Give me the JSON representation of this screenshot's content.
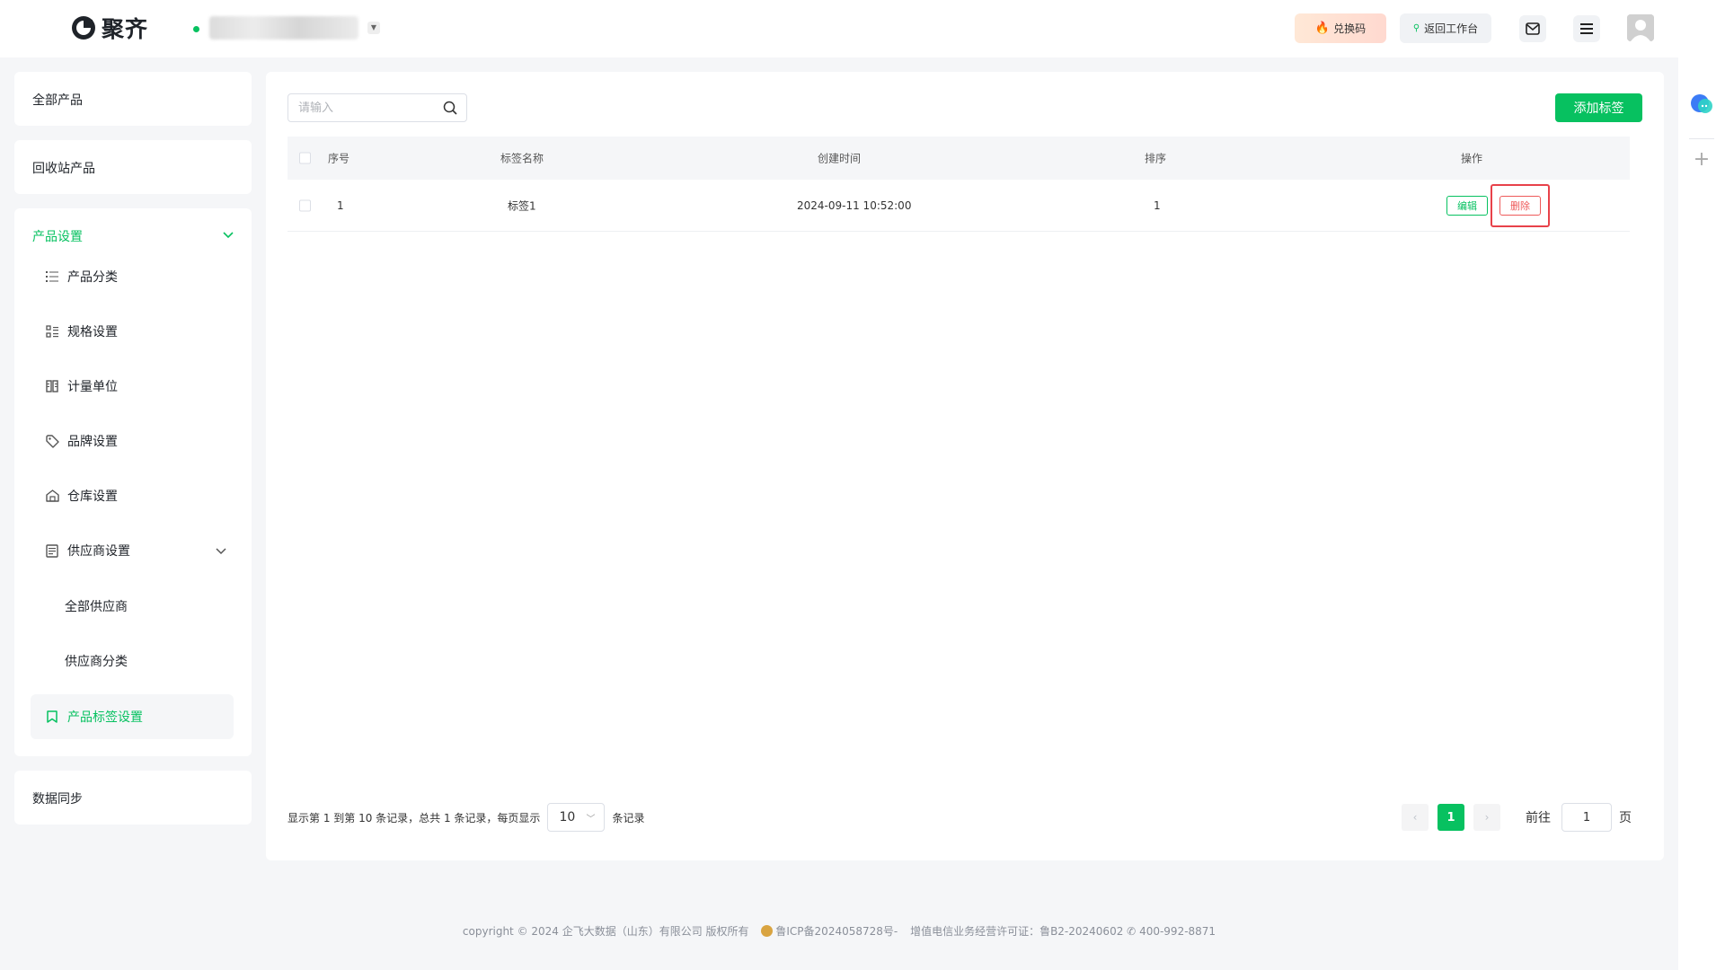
{
  "header": {
    "brand": "聚齐",
    "redeem_label": "兑换码",
    "back_label": "返回工作台"
  },
  "sidebar": {
    "all_products": "全部产品",
    "recycle_products": "回收站产品",
    "product_settings": "产品设置",
    "items": [
      {
        "label": "产品分类",
        "icon": "list-icon"
      },
      {
        "label": "规格设置",
        "icon": "spec-icon"
      },
      {
        "label": "计量单位",
        "icon": "ruler-icon"
      },
      {
        "label": "品牌设置",
        "icon": "tag-icon"
      },
      {
        "label": "仓库设置",
        "icon": "warehouse-icon"
      },
      {
        "label": "供应商设置",
        "icon": "supplier-icon"
      }
    ],
    "supplier_sub": [
      "全部供应商",
      "供应商分类"
    ],
    "tag_settings": "产品标签设置",
    "data_sync": "数据同步"
  },
  "toolbar": {
    "search_placeholder": "请输入",
    "add_label": "添加标签"
  },
  "table": {
    "headers": [
      "序号",
      "标签名称",
      "创建时间",
      "排序",
      "操作"
    ],
    "rows": [
      {
        "index": "1",
        "name": "标签1",
        "created": "2024-09-11 10:52:00",
        "sort": "1",
        "edit": "编辑",
        "delete": "删除"
      }
    ]
  },
  "pagination": {
    "summary": "显示第 1 到第 10 条记录，总共 1 条记录，每页显示",
    "page_size": "10",
    "unit": "条记录",
    "current_page": "1",
    "goto_label": "前往",
    "goto_value": "1",
    "page_suffix": "页"
  },
  "footer": {
    "copyright": "copyright © 2024 企飞大数据（山东）有限公司 版权所有",
    "icp": "鲁ICP备2024058728号-",
    "license": "增值电信业务经营许可证：鲁B2-20240602",
    "phone": "400-992-8871"
  },
  "colors": {
    "accent": "#07c160",
    "danger": "#ee5a5a"
  }
}
